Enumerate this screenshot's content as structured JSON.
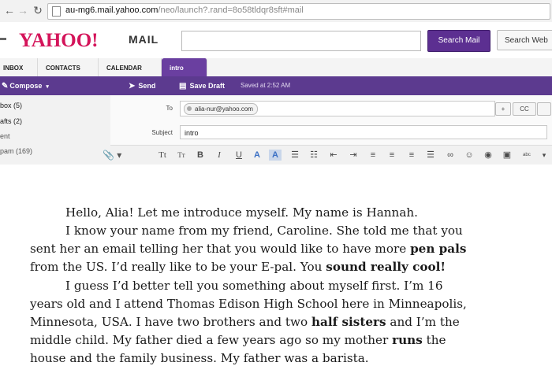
{
  "browser": {
    "url_host": "au-mg6.mail.yahoo.com",
    "url_rest": "/neo/launch?.rand=8o58tldqr8sft#mail"
  },
  "header": {
    "logo": "YAHOO!",
    "logo_mail": "MAIL",
    "search_button": "Search Mail",
    "search_web_button": "Search Web"
  },
  "tabs": [
    "INBOX",
    "CONTACTS",
    "CALENDAR",
    "intro"
  ],
  "toolbar": {
    "compose": "Compose",
    "send": "Send",
    "save_draft": "Save Draft",
    "saved_status": "Saved at 2:52 AM"
  },
  "sidebar": {
    "folders": [
      "box (5)",
      "afts (2)",
      "ent",
      "pam (169)"
    ]
  },
  "compose": {
    "to_label": "To",
    "to_recipient": "alia-nur@yahoo.com",
    "subject_label": "Subject",
    "subject_value": "intro",
    "cc_label": "CC",
    "plus_label": "+"
  },
  "letter": {
    "l1": "Hello, Alia! Let me introduce myself. My name is Hannah.",
    "l2": "I know your name from my friend, Caroline. She told me that you",
    "l3a": "sent her an email telling her that you would like to have more ",
    "l3b": "pen pals",
    "l4a": "from the US. I’d really like to be your E-pal. You ",
    "l4b": "sound really cool!",
    "l5": "I guess I’d better tell you something about myself first. I’m 16",
    "l6": "years old and I attend Thomas Edison High School here in Minneapolis,",
    "l7a": "Minnesota, USA. I have two brothers and two ",
    "l7b": "half sisters",
    "l7c": " and I’m the",
    "l8a": "middle child. My father died a few years ago so my mother ",
    "l8b": "runs",
    "l8c": " the",
    "l9": "house and the family business. My father was a barista."
  }
}
